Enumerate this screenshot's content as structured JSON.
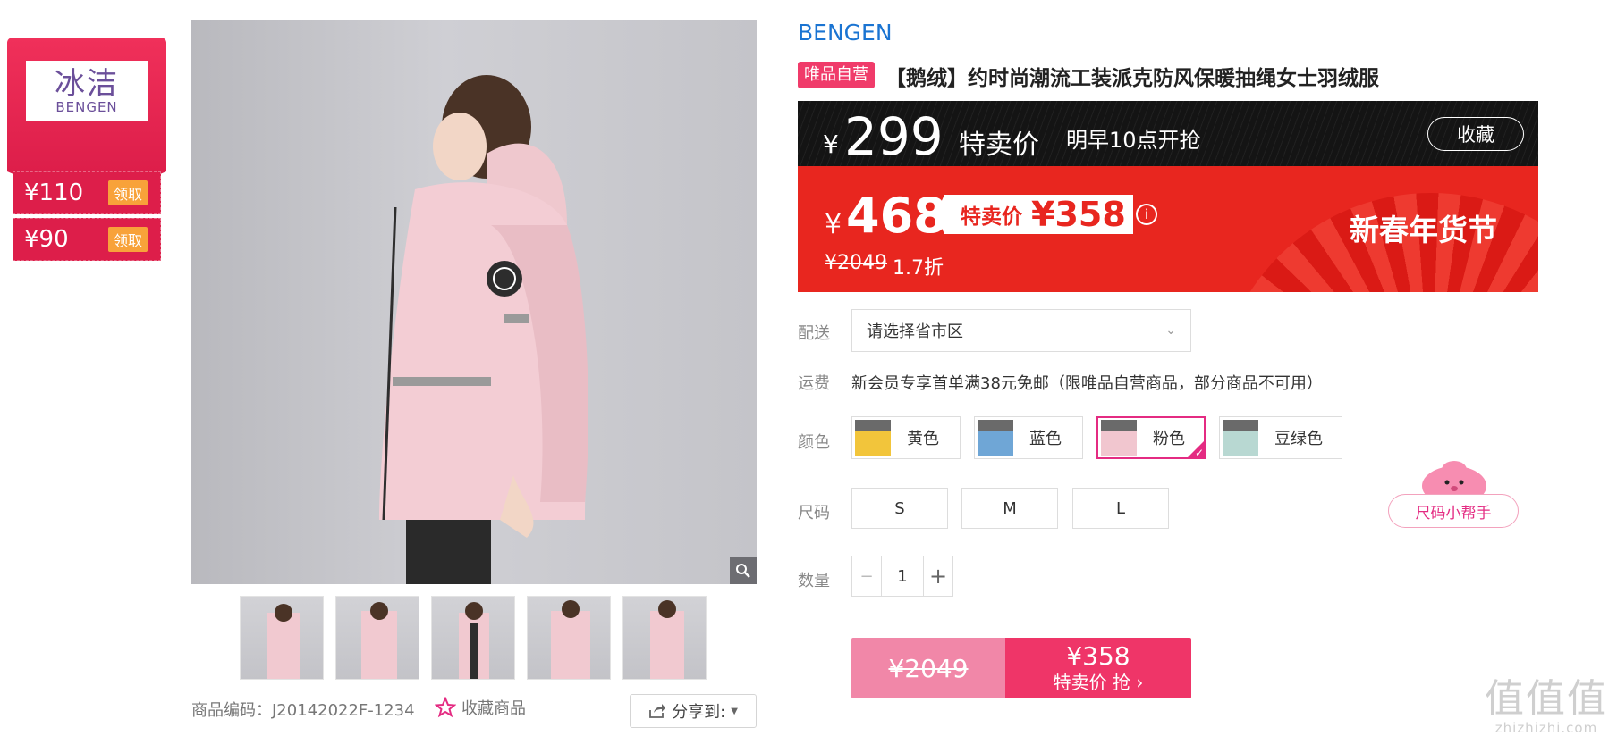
{
  "brand_card": {
    "logo_cn": "冰洁",
    "logo_en": "BENGEN",
    "coupons": [
      {
        "amount": "¥110",
        "action": "领取"
      },
      {
        "amount": "¥90",
        "action": "领取"
      }
    ]
  },
  "gallery": {
    "thumb_count": 5,
    "product_code": "商品编码：J20142022F-1234",
    "favorite_label": "收藏商品",
    "share_label": "分享到:"
  },
  "product": {
    "brand": "BENGEN",
    "badge": "唯品自营",
    "title": "【鹅绒】约时尚潮流工装派克防风保暖抽绳女士羽绒服"
  },
  "price_top": {
    "currency": "¥",
    "price": "299",
    "label": "特卖价",
    "start_time": "明早10点开抢",
    "favorite_button": "收藏"
  },
  "price_red": {
    "currency": "¥",
    "price": "468",
    "tag_label": "特卖价",
    "tag_price": "¥358",
    "info_icon": "i",
    "original": "¥2049",
    "discount": "1.7折",
    "festival": "新春年货节"
  },
  "delivery": {
    "label": "配送",
    "placeholder": "请选择省市区"
  },
  "shipping": {
    "label": "运费",
    "text": "新会员专享首单满38元免邮（限唯品自营商品，部分商品不可用）"
  },
  "colors": {
    "label": "颜色",
    "options": [
      {
        "name": "黄色",
        "swatch": "#f2c53b",
        "selected": false
      },
      {
        "name": "蓝色",
        "swatch": "#6fa6d6",
        "selected": false
      },
      {
        "name": "粉色",
        "swatch": "#f1c6cf",
        "selected": true
      },
      {
        "name": "豆绿色",
        "swatch": "#b8d8d2",
        "selected": false
      }
    ]
  },
  "sizes": {
    "label": "尺码",
    "options": [
      "S",
      "M",
      "L"
    ],
    "helper": "尺码小帮手"
  },
  "quantity": {
    "label": "数量",
    "minus": "−",
    "value": "1",
    "plus": "+"
  },
  "buy": {
    "original": "¥2049",
    "price": "¥358",
    "action": "特卖价 抢 ›"
  },
  "watermark": {
    "big": "值值值",
    "small": "zhizhizhi.com"
  },
  "colors_theme": {
    "accent_pink": "#ef3568",
    "brand_blue": "#1a74d2",
    "red_banner": "#e8261f"
  }
}
